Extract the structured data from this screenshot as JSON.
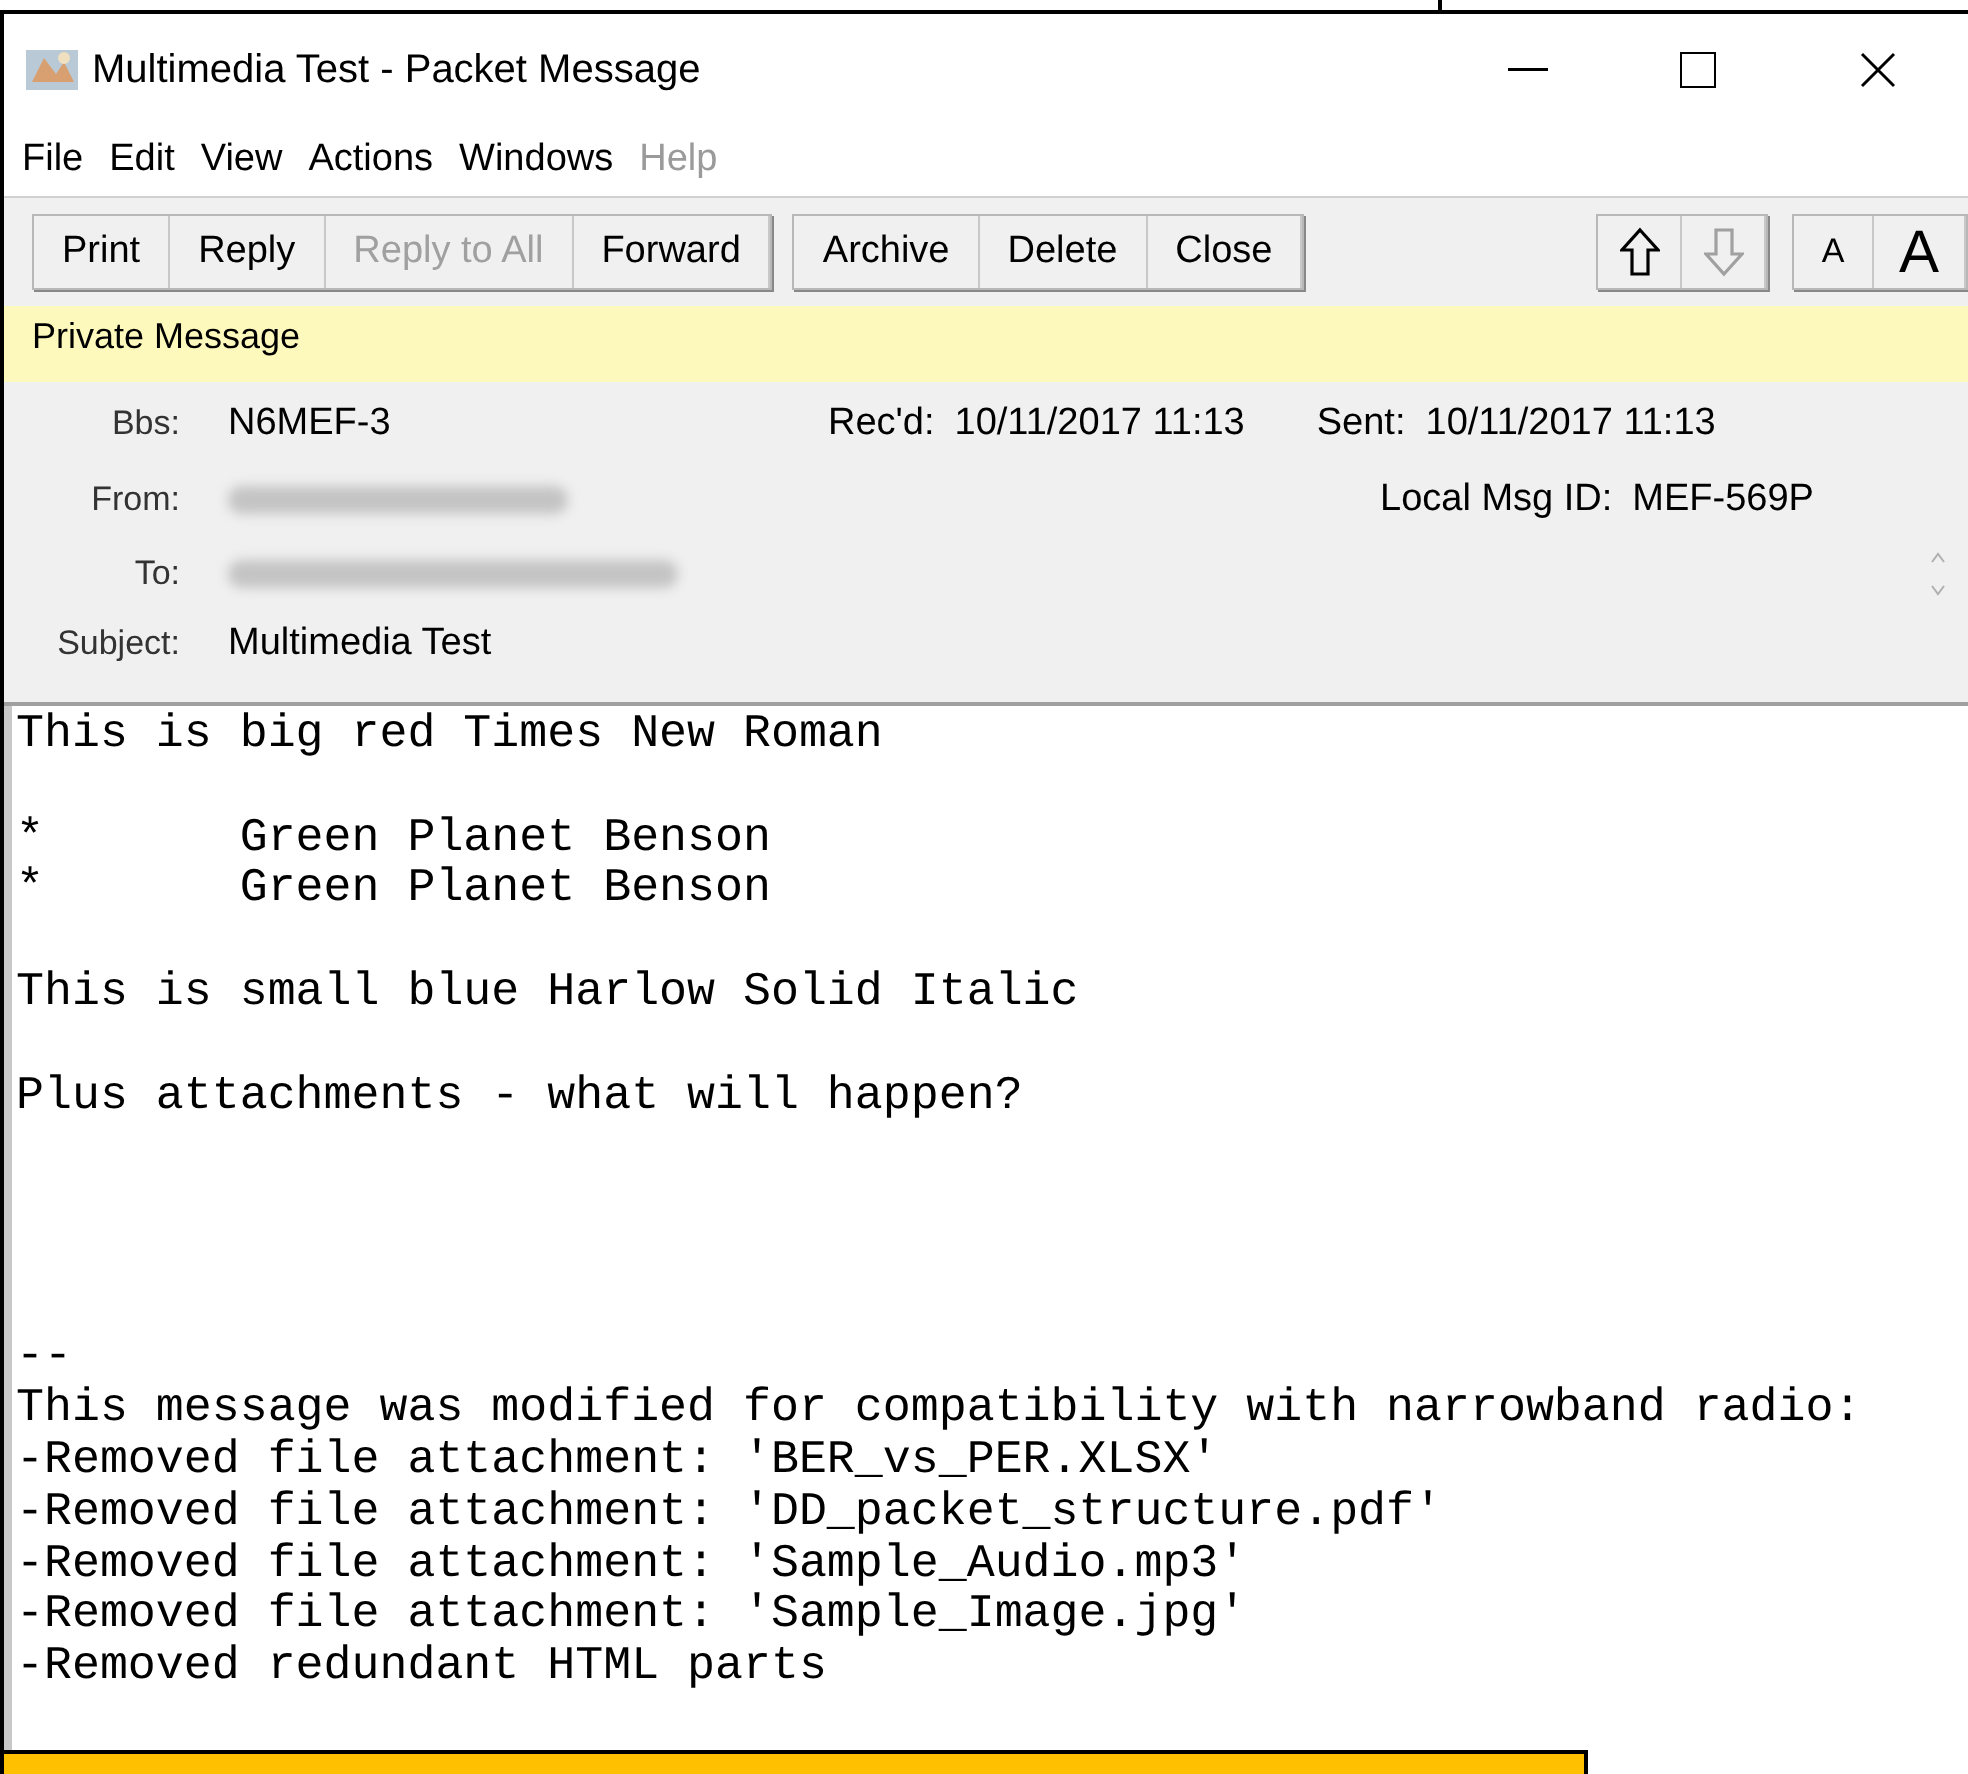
{
  "window": {
    "title": "Multimedia Test - Packet Message"
  },
  "menu": [
    {
      "label": "File",
      "disabled": false
    },
    {
      "label": "Edit",
      "disabled": false
    },
    {
      "label": "View",
      "disabled": false
    },
    {
      "label": "Actions",
      "disabled": false
    },
    {
      "label": "Windows",
      "disabled": false
    },
    {
      "label": "Help",
      "disabled": true
    }
  ],
  "toolbar": {
    "groups": [
      [
        {
          "label": "Print",
          "disabled": false
        },
        {
          "label": "Reply",
          "disabled": false
        },
        {
          "label": "Reply to All",
          "disabled": true
        },
        {
          "label": "Forward",
          "disabled": false
        }
      ],
      [
        {
          "label": "Archive",
          "disabled": false
        },
        {
          "label": "Delete",
          "disabled": false
        },
        {
          "label": "Close",
          "disabled": false
        }
      ]
    ],
    "nav": [
      {
        "kind": "up",
        "disabled": false
      },
      {
        "kind": "down",
        "disabled": true
      }
    ],
    "font_size": [
      {
        "label": "A",
        "kind": "small"
      },
      {
        "label": "A",
        "kind": "large"
      }
    ]
  },
  "banner": "Private Message",
  "header": {
    "bbs_label": "Bbs:",
    "bbs": "N6MEF-3",
    "from_label": "From:",
    "to_label": "To:",
    "subject_label": "Subject:",
    "subject": "Multimedia Test",
    "recd_label": "Rec'd:",
    "recd": "10/11/2017 11:13",
    "sent_label": "Sent:",
    "sent": "10/11/2017 11:13",
    "msg_id_label": "Local Msg ID:",
    "msg_id": "MEF-569P"
  },
  "body": {
    "paragraphs": [
      [
        "This is big red Times New Roman"
      ],
      [
        "*       Green Planet Benson",
        "*       Green Planet Benson"
      ],
      [
        "This is small blue Harlow Solid Italic"
      ],
      [
        "Plus attachments - what will happen?"
      ]
    ],
    "signature": [
      "--",
      "This message was modified for compatibility with narrowband radio:",
      "-Removed file attachment: 'BER_vs_PER.XLSX'",
      "-Removed file attachment: 'DD_packet_structure.pdf'",
      "-Removed file attachment: 'Sample_Audio.mp3'",
      "-Removed file attachment: 'Sample_Image.jpg'",
      "-Removed redundant HTML parts"
    ]
  }
}
